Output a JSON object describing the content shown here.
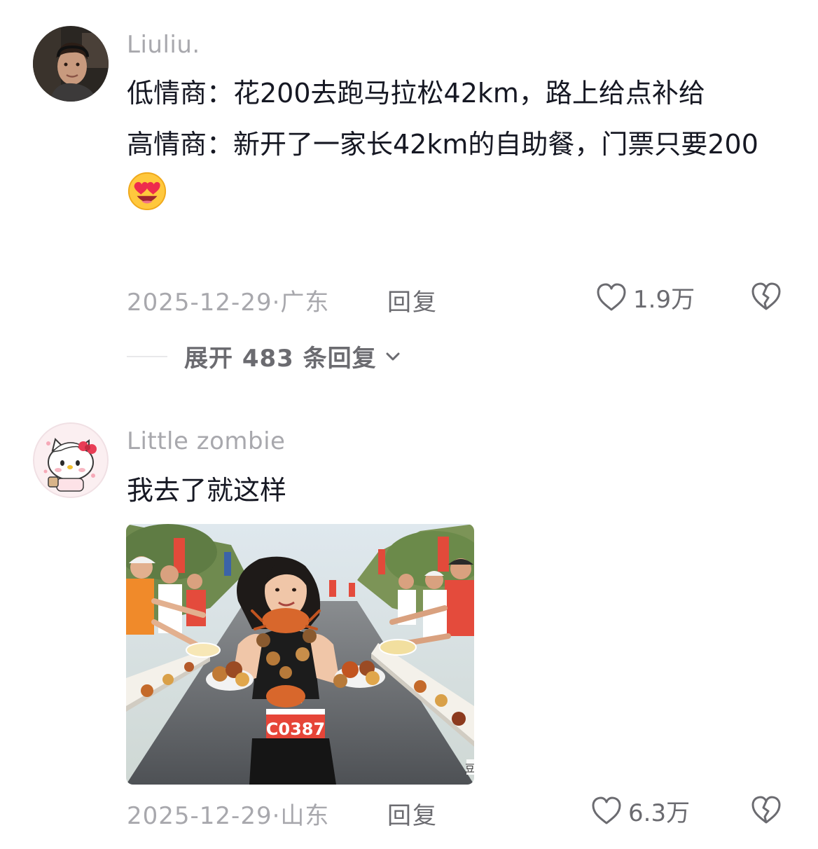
{
  "comments": [
    {
      "username": "Liuliu.",
      "lines": [
        "低情商：花200去跑马拉松42km，路上给点补给",
        "高情商：新开了一家长42km的自助餐，门票只要200"
      ],
      "emoji": "heart-eyes-emoji",
      "date": "2025-12-29",
      "location": "广东",
      "reply_label": "回复",
      "likes": "1.9万",
      "expand_label": "展开 483 条回复"
    },
    {
      "username": "Little zombie",
      "text": "我去了就这样",
      "image_bib": "C0387",
      "image_corner_text": "豆",
      "date": "2025-12-29",
      "location": "山东",
      "reply_label": "回复",
      "likes": "6.3万"
    }
  ],
  "date_sep": "·",
  "colors": {
    "meta_gray": "#a8a8ad",
    "action_gray": "#6b6b70",
    "text": "#161823"
  }
}
